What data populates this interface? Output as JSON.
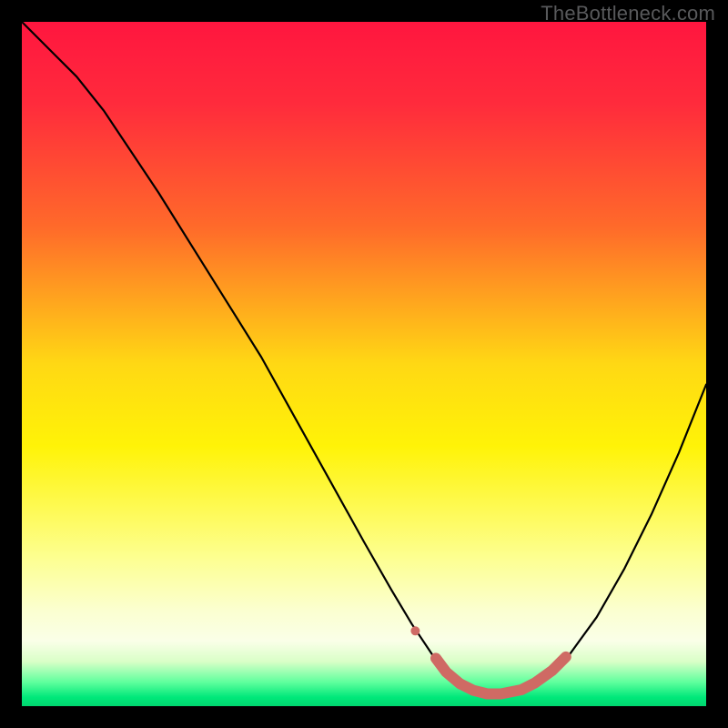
{
  "watermark": "TheBottleneck.com",
  "chart_data": {
    "type": "line",
    "title": "",
    "xlabel": "",
    "ylabel": "",
    "xlim": [
      0,
      100
    ],
    "ylim": [
      0,
      100
    ],
    "gradient_stops": [
      {
        "offset": 0.0,
        "color": "#ff163f"
      },
      {
        "offset": 0.12,
        "color": "#ff2b3c"
      },
      {
        "offset": 0.3,
        "color": "#ff6a2a"
      },
      {
        "offset": 0.5,
        "color": "#ffd814"
      },
      {
        "offset": 0.62,
        "color": "#fff307"
      },
      {
        "offset": 0.78,
        "color": "#fdff8e"
      },
      {
        "offset": 0.86,
        "color": "#fbffd0"
      },
      {
        "offset": 0.905,
        "color": "#faffe8"
      },
      {
        "offset": 0.935,
        "color": "#d9ffc7"
      },
      {
        "offset": 0.965,
        "color": "#5fff9d"
      },
      {
        "offset": 0.987,
        "color": "#00e87a"
      },
      {
        "offset": 1.0,
        "color": "#00d56f"
      }
    ],
    "series": [
      {
        "name": "bottleneck-curve",
        "color": "#000000",
        "width": 2.2,
        "x": [
          0,
          2,
          5,
          8,
          12,
          16,
          20,
          25,
          30,
          35,
          40,
          45,
          50,
          54,
          57,
          60,
          62,
          64,
          66,
          68,
          70,
          73,
          76,
          80,
          84,
          88,
          92,
          96,
          100
        ],
        "values": [
          100,
          98,
          95,
          92,
          87,
          81,
          75,
          67,
          59,
          51,
          42,
          33,
          24,
          17,
          12,
          7.5,
          5.0,
          3.3,
          2.3,
          1.8,
          1.8,
          2.4,
          4.0,
          7.5,
          13,
          20,
          28,
          37,
          47
        ]
      }
    ],
    "highlight": {
      "name": "optimal-range",
      "color": "#cf6a64",
      "dot": {
        "x": 57.5,
        "y": 11.0,
        "r": 5
      },
      "thick": {
        "x": [
          60.5,
          62,
          64,
          66,
          68,
          70,
          73,
          75,
          77.5,
          79.5
        ],
        "values": [
          7.0,
          5.0,
          3.3,
          2.3,
          1.8,
          1.8,
          2.4,
          3.4,
          5.2,
          7.2
        ],
        "width": 12
      }
    }
  }
}
